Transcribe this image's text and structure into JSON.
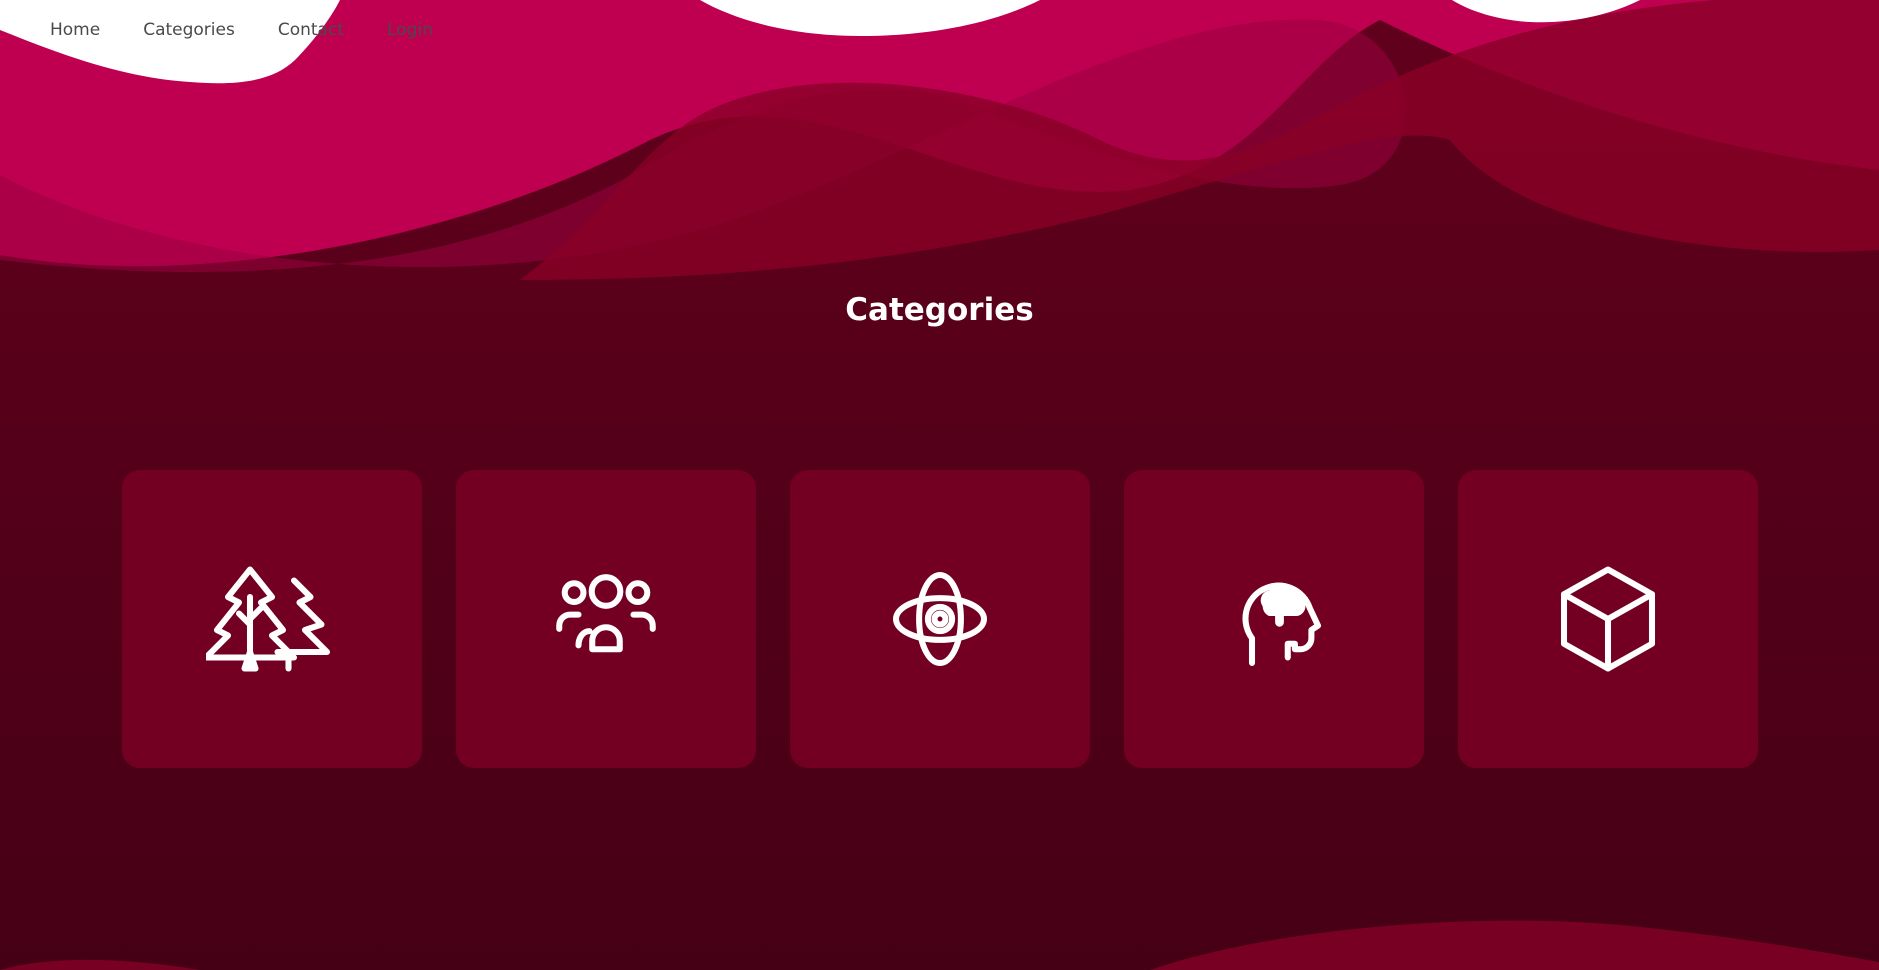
{
  "nav": {
    "items": [
      {
        "label": "Home"
      },
      {
        "label": "Categories"
      },
      {
        "label": "Contact"
      },
      {
        "label": "Login"
      }
    ]
  },
  "main": {
    "title": "Categories",
    "categories": [
      {
        "icon": "trees-icon"
      },
      {
        "icon": "users-group-icon"
      },
      {
        "icon": "atom-icon"
      },
      {
        "icon": "head-brain-icon"
      },
      {
        "icon": "cube-icon"
      }
    ]
  },
  "colors": {
    "background_dark": "#55001a",
    "card": "#730022",
    "wave_pink": "#bf0051",
    "wave_crimson": "#8a0027",
    "wave_magenta": "#9a003f",
    "text_white": "#ffffff",
    "nav_text": "#4a4a4a"
  }
}
